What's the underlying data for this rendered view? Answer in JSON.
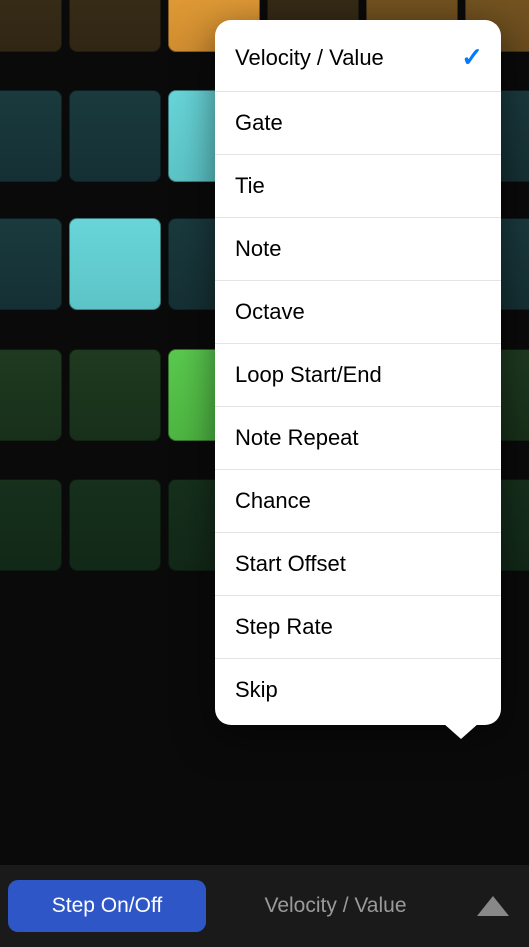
{
  "colors": {
    "primary_button": "#2e56c7",
    "accent_check": "#007aff"
  },
  "grid": {
    "rows": [
      {
        "pads": [
          "orange-dark",
          "orange-dark",
          "orange-bright",
          "orange-dark",
          "orange-dim",
          "orange-dim"
        ]
      },
      {
        "pads": [
          "cyan-dark",
          "cyan-dark",
          "cyan-bright",
          "cyan-dark",
          "cyan-dark",
          "cyan-dark"
        ]
      },
      {
        "pads": [
          "cyan-dark",
          "cyan-bright",
          "cyan-dark",
          "cyan-dark",
          "cyan-dark",
          "cyan-dark"
        ]
      },
      {
        "pads": [
          "green-dark",
          "green-dark",
          "green-bright",
          "green-dark",
          "green-dark",
          "green-dark"
        ]
      },
      {
        "pads": [
          "green-darker",
          "green-darker",
          "green-darker",
          "green-darker",
          "green-darker",
          "green-darker"
        ]
      }
    ]
  },
  "bottom_bar": {
    "primary_label": "Step On/Off",
    "secondary_label": "Velocity / Value"
  },
  "popover": {
    "items": [
      {
        "label": "Velocity / Value",
        "selected": true
      },
      {
        "label": "Gate",
        "selected": false
      },
      {
        "label": "Tie",
        "selected": false
      },
      {
        "label": "Note",
        "selected": false
      },
      {
        "label": "Octave",
        "selected": false
      },
      {
        "label": "Loop Start/End",
        "selected": false
      },
      {
        "label": "Note Repeat",
        "selected": false
      },
      {
        "label": "Chance",
        "selected": false
      },
      {
        "label": "Start Offset",
        "selected": false
      },
      {
        "label": "Step Rate",
        "selected": false
      },
      {
        "label": "Skip",
        "selected": false
      }
    ]
  }
}
